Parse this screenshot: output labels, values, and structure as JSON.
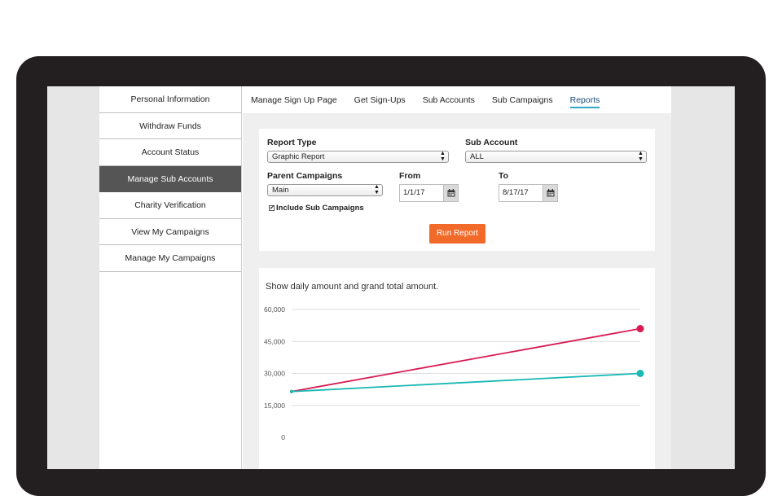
{
  "sidebar": {
    "items": [
      {
        "label": "Personal Information"
      },
      {
        "label": "Withdraw Funds"
      },
      {
        "label": "Account Status"
      },
      {
        "label": "Manage Sub Accounts"
      },
      {
        "label": "Charity Verification"
      },
      {
        "label": "View My Campaigns"
      },
      {
        "label": "Manage My Campaigns"
      }
    ],
    "active_index": 3
  },
  "tabs": [
    {
      "label": "Manage Sign Up Page"
    },
    {
      "label": "Get Sign-Ups"
    },
    {
      "label": "Sub Accounts"
    },
    {
      "label": "Sub Campaigns"
    },
    {
      "label": "Reports"
    }
  ],
  "form": {
    "report_type_label": "Report Type",
    "report_type_value": "Graphic Report",
    "sub_account_label": "Sub Account",
    "sub_account_value": "ALL",
    "parent_campaigns_label": "Parent Campaigns",
    "parent_campaigns_value": "Main",
    "from_label": "From",
    "from_value": "1/1/17",
    "to_label": "To",
    "to_value": "8/17/17",
    "include_sub_label": "Include Sub Campaigns",
    "include_sub_checked": "✔",
    "run_button": "Run Report"
  },
  "chart_data": {
    "type": "line",
    "title": "Show daily amount and grand total amount.",
    "xlabel": "",
    "ylabel": "",
    "ylim": [
      0,
      60000
    ],
    "yticks": [
      "60,000",
      "45,000",
      "30,000",
      "15,000",
      "0"
    ],
    "ytick_values": [
      60000,
      45000,
      30000,
      15000,
      0
    ],
    "x": [
      0,
      1
    ],
    "series": [
      {
        "values": [
          21500,
          51000
        ],
        "color": "#d81b52"
      },
      {
        "values": [
          21500,
          30000
        ],
        "color": "#19b9b4"
      }
    ],
    "grid": true
  }
}
